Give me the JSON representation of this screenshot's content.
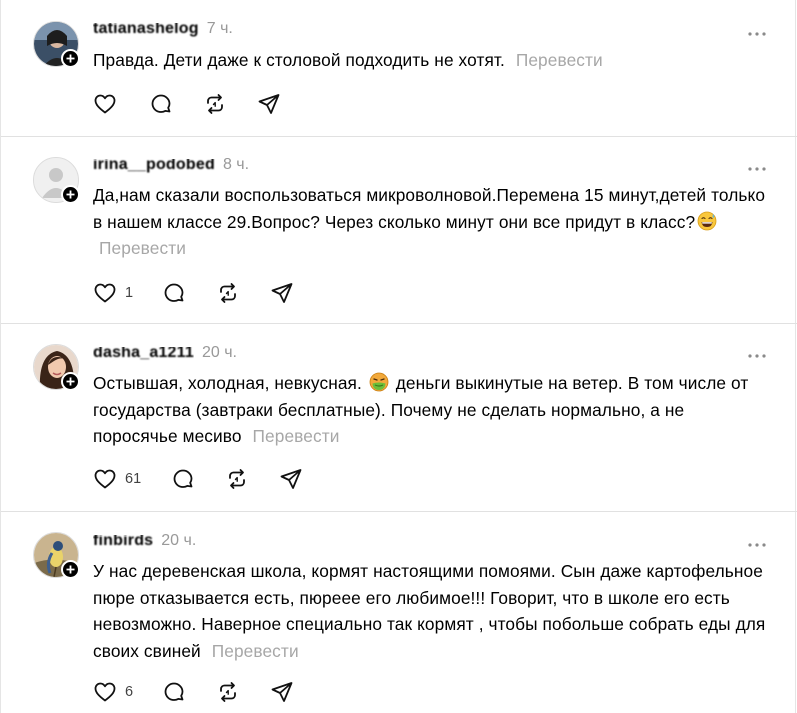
{
  "translate_label": "Перевести",
  "comments": [
    {
      "username": "tatianashelog",
      "time": "7 ч.",
      "text": "Правда. Дети даже к столовой подходить не хотят.",
      "likes": ""
    },
    {
      "username": "irina__podobed",
      "time": "8 ч.",
      "text_before_emoji": "Да,нам сказали воспользоваться микроволновой.Перемена 15 минут,детей только в нашем классе 29.Вопрос? Через сколько минут они все придут в класс?",
      "emoji": "grinning-sweat-emoji",
      "likes": "1"
    },
    {
      "username": "dasha_a1211",
      "time": "20 ч.",
      "text_before_emoji": "Остывшая, холодная, невкусная.",
      "emoji": "nauseated-face-emoji",
      "text_after_emoji": "деньги выкинутые на ветер. В том числе от государства (завтраки бесплатные). Почему не сделать нормально, а не поросячье месиво",
      "likes": "61"
    },
    {
      "username": "finbirds",
      "time": "20 ч.",
      "text": "У нас деревенская школа, кормят настоящими помоями. Сын даже картофельное пюре отказывается есть, пюреее его любимое!!! Говорит, что в школе его есть невозможно. Наверное специально так кормят , чтобы побольше собрать еды для своих свиней",
      "likes": "6"
    }
  ],
  "colors": {
    "text": "#000000",
    "muted": "#999999",
    "translate": "#a7a7a7",
    "divider": "#e1e1e1"
  }
}
